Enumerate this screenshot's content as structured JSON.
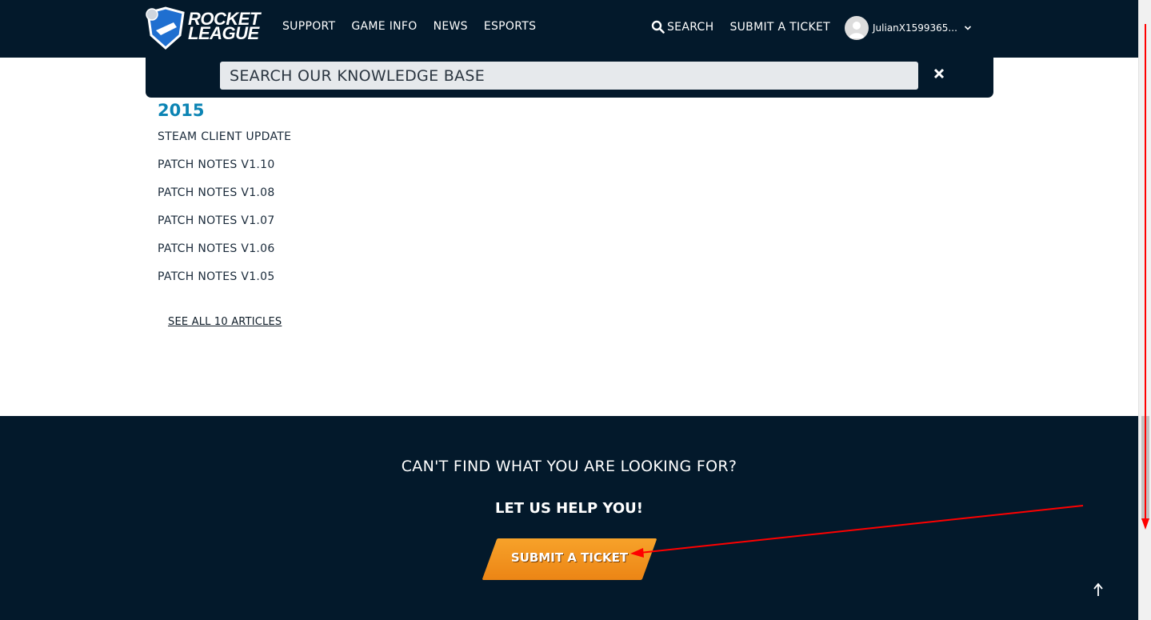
{
  "header": {
    "logo_text_1": "ROCKET",
    "logo_text_2": "LEAGUE",
    "nav_left": [
      "SUPPORT",
      "GAME INFO",
      "NEWS",
      "ESPORTS"
    ],
    "search_label": "SEARCH",
    "submit_ticket_label": "SUBMIT A TICKET",
    "user_name": "JulianX1599365..."
  },
  "search": {
    "placeholder": "SEARCH OUR KNOWLEDGE BASE"
  },
  "section": {
    "year": "2015",
    "articles": [
      "STEAM CLIENT UPDATE",
      "PATCH NOTES V1.10",
      "PATCH NOTES V1.08",
      "PATCH NOTES V1.07",
      "PATCH NOTES V1.06",
      "PATCH NOTES V1.05"
    ],
    "see_all": "SEE ALL 10 ARTICLES"
  },
  "footer": {
    "question": "CAN'T FIND WHAT YOU ARE LOOKING FOR?",
    "help": "LET US HELP YOU!",
    "button_label": "SUBMIT A TICKET"
  },
  "colors": {
    "navy": "#03192b",
    "accent_blue": "#0b84b4",
    "orange": "#f39020",
    "annotation_red": "#ff0000"
  },
  "icons": [
    "rocket-league-logo",
    "search-icon",
    "avatar-icon",
    "chevron-down-icon",
    "close-icon",
    "arrow-up-icon"
  ]
}
